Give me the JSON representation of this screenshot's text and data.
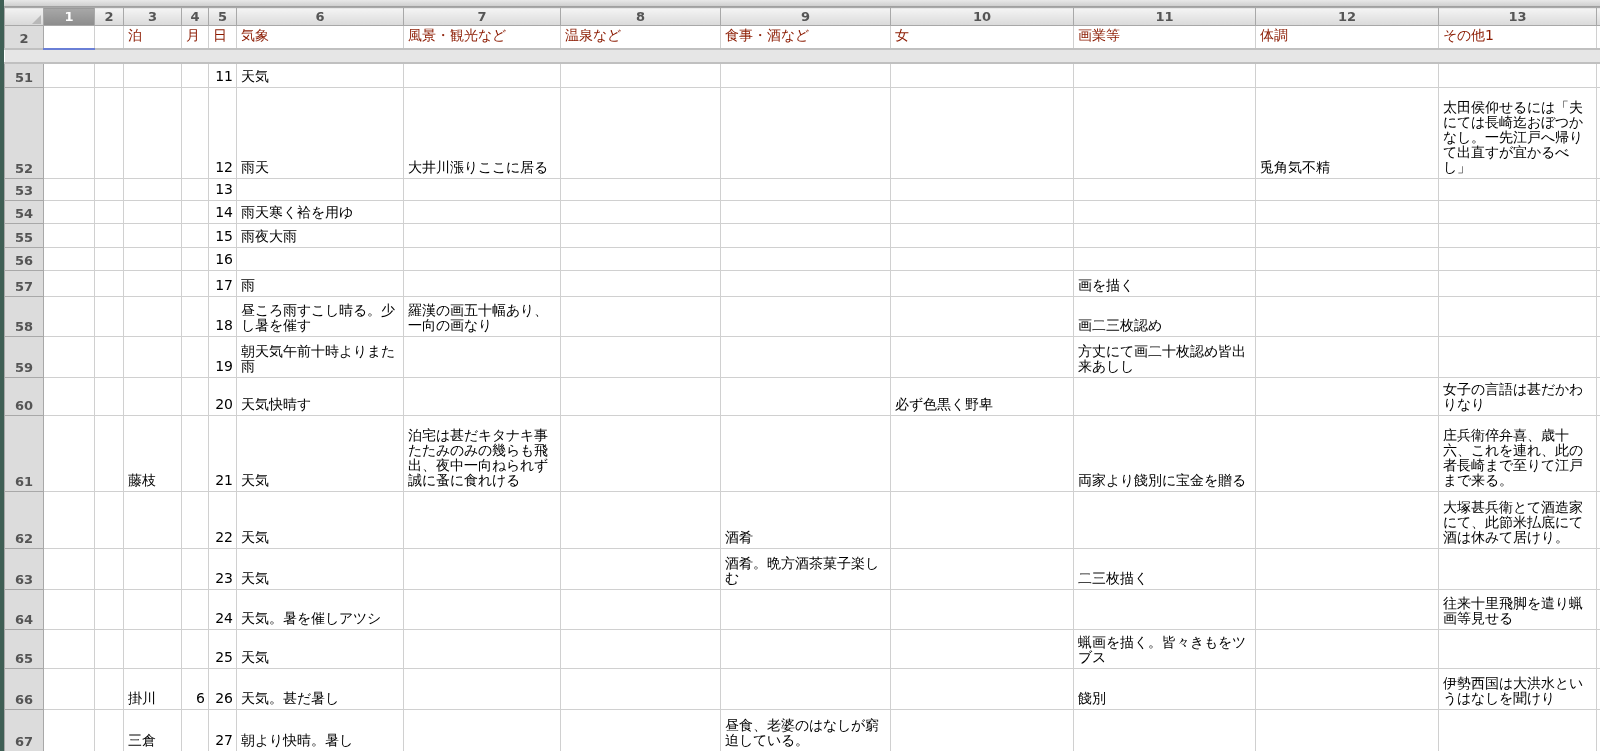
{
  "columns": [
    {
      "label": "1",
      "selected": true
    },
    {
      "label": "2",
      "selected": false
    },
    {
      "label": "3",
      "selected": false
    },
    {
      "label": "4",
      "selected": false
    },
    {
      "label": "5",
      "selected": false
    },
    {
      "label": "6",
      "selected": false
    },
    {
      "label": "7",
      "selected": false
    },
    {
      "label": "8",
      "selected": false
    },
    {
      "label": "9",
      "selected": false
    },
    {
      "label": "10",
      "selected": false
    },
    {
      "label": "11",
      "selected": false
    },
    {
      "label": "12",
      "selected": false
    },
    {
      "label": "13",
      "selected": false
    }
  ],
  "header_row": {
    "number": "2",
    "lodging": "泊",
    "month": "月",
    "day": "日",
    "weather": "気象",
    "scenery": "風景・観光など",
    "hot_spring": "温泉など",
    "food": "食事・酒など",
    "women": "女",
    "painting": "画業等",
    "health": "体調",
    "other": "その他1"
  },
  "rows": [
    {
      "number": "51",
      "day": "11",
      "weather": "天気"
    },
    {
      "number": "52",
      "day": "12",
      "weather": "雨天",
      "scenery": "大井川漲りここに居る",
      "health": "兎角気不精",
      "other": "太田侯仰せるには「夫にては長崎迄おぼつかなし。一先江戸へ帰りて出直すが宜かるべし」"
    },
    {
      "number": "53",
      "day": "13"
    },
    {
      "number": "54",
      "day": "14",
      "weather": "雨天寒く袷を用ゆ"
    },
    {
      "number": "55",
      "day": "15",
      "weather": "雨夜大雨"
    },
    {
      "number": "56",
      "day": "16"
    },
    {
      "number": "57",
      "day": "17",
      "weather": "雨",
      "painting": "画を描く"
    },
    {
      "number": "58",
      "day": "18",
      "weather": "昼ころ雨すこし晴る。少し暑を催す",
      "scenery": "羅漢の画五十幅あり、一向の画なり",
      "painting": "画二三枚認め"
    },
    {
      "number": "59",
      "day": "19",
      "weather": "朝天気午前十時よりまた雨",
      "painting": "方丈にて画二十枚認め皆出来あしし"
    },
    {
      "number": "60",
      "day": "20",
      "weather": "天気快晴す",
      "women": "必ず色黒く野卑",
      "other": "女子の言語は甚だかわりなり"
    },
    {
      "number": "61",
      "lodging": "藤枝",
      "day": "21",
      "weather": "天気",
      "scenery": "泊宅は甚だキタナキ事たたみのみの幾らも飛出、夜中一向ねられず誠に蚤に食れける",
      "painting": "両家より餞別に宝金を贈る",
      "other": "庄兵衛倅弁喜、歳十六、これを連れ、此の者長崎まで至りて江戸まで来る。"
    },
    {
      "number": "62",
      "day": "22",
      "weather": "天気",
      "food": "酒肴",
      "other": "大塚甚兵衛とて酒造家にて、此節米払底にて酒は休みて居けり。"
    },
    {
      "number": "63",
      "day": "23",
      "weather": "天気",
      "food": "酒肴。晩方酒茶菓子楽しむ",
      "painting": "二三枚描く"
    },
    {
      "number": "64",
      "day": "24",
      "weather": "天気。暑を催しアツシ",
      "other": "往来十里飛脚を遣り蝋画等見せる"
    },
    {
      "number": "65",
      "day": "25",
      "weather": "天気",
      "painting": "蝋画を描く。皆々きもをツブス"
    },
    {
      "number": "66",
      "lodging": "掛川",
      "month": "6",
      "day": "26",
      "weather": "天気。甚だ暑し",
      "painting": "餞別",
      "other": "伊勢西国は大洪水というはなしを聞けり"
    },
    {
      "number": "67",
      "lodging": "三倉",
      "day": "27",
      "weather": "朝より快晴。暑し",
      "food": "昼食、老婆のはなしが窮迫している。"
    }
  ]
}
